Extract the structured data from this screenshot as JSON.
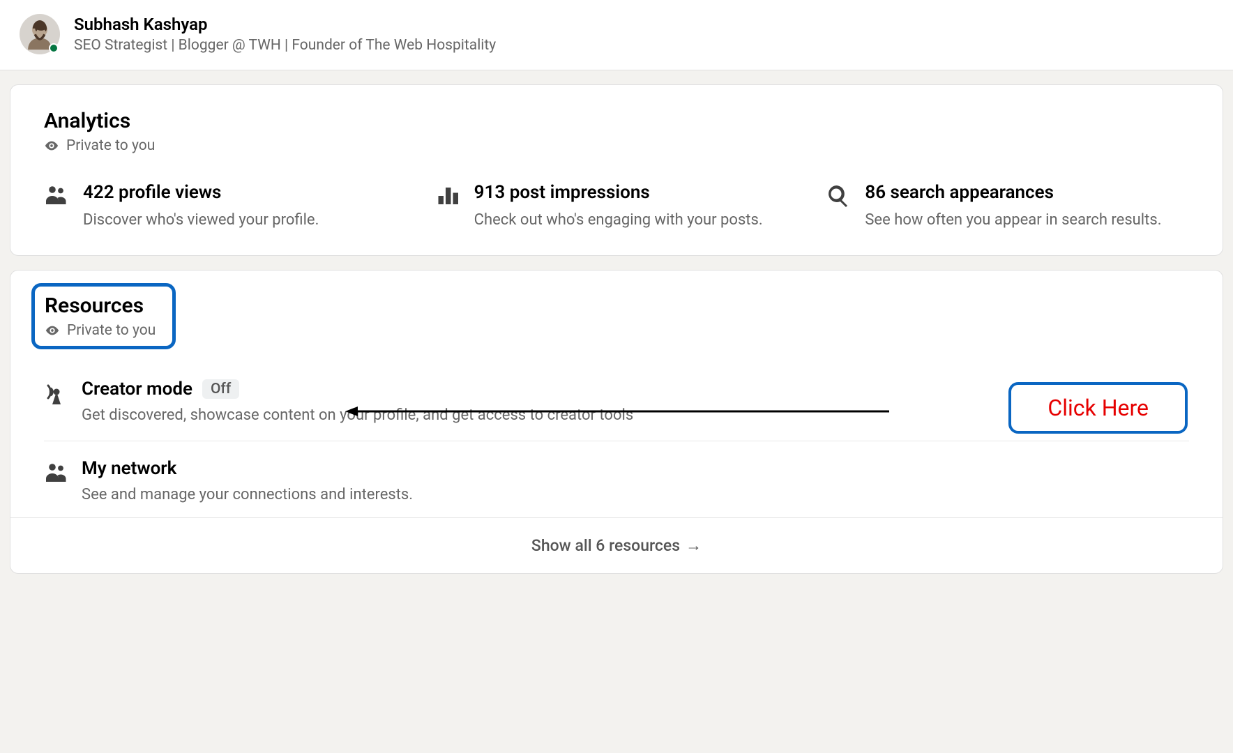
{
  "header": {
    "name": "Subhash Kashyap",
    "subtitle": "SEO Strategist | Blogger @ TWH | Founder of The Web Hospitality"
  },
  "analytics": {
    "title": "Analytics",
    "private_label": "Private to you",
    "stats": [
      {
        "title": "422 profile views",
        "desc": "Discover who's viewed your profile."
      },
      {
        "title": "913 post impressions",
        "desc": "Check out who's engaging with your posts."
      },
      {
        "title": "86 search appearances",
        "desc": "See how often you appear in search results."
      }
    ]
  },
  "resources": {
    "title": "Resources",
    "private_label": "Private to you",
    "items": [
      {
        "title": "Creator mode",
        "badge": "Off",
        "desc": "Get discovered, showcase content on your profile, and get access to creator tools"
      },
      {
        "title": "My network",
        "desc": "See and manage your connections and interests."
      }
    ],
    "show_all": "Show all 6 resources"
  },
  "annotation": {
    "click_here": "Click Here"
  }
}
